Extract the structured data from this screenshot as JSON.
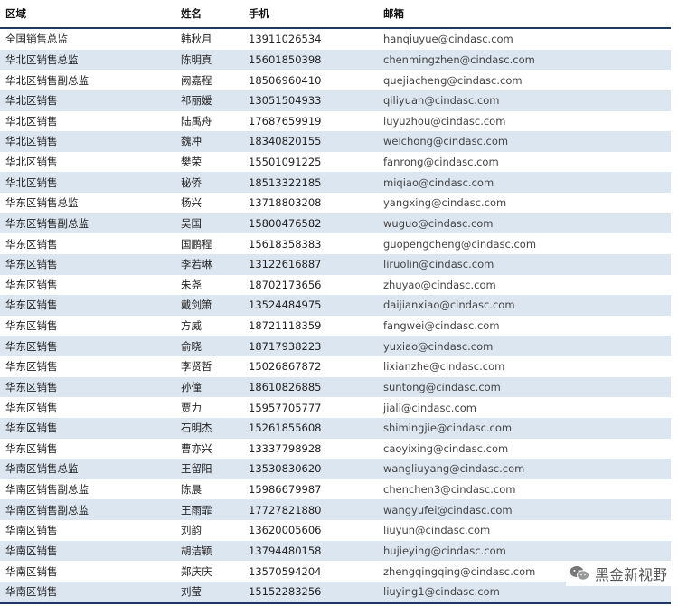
{
  "table": {
    "headers": [
      "区域",
      "姓名",
      "手机",
      "邮箱"
    ],
    "rows": [
      [
        "全国销售总监",
        "韩秋月",
        "13911026534",
        "hanqiuyue@cindasc.com"
      ],
      [
        "华北区销售总监",
        "陈明真",
        "15601850398",
        "chenmingzhen@cindasc.com"
      ],
      [
        "华北区销售副总监",
        "阙嘉程",
        "18506960410",
        "quejiacheng@cindasc.com"
      ],
      [
        "华北区销售",
        "祁丽媛",
        "13051504933",
        "qiliyuan@cindasc.com"
      ],
      [
        "华北区销售",
        "陆禹舟",
        "17687659919",
        "luyuzhou@cindasc.com"
      ],
      [
        "华北区销售",
        "魏冲",
        "18340820155",
        "weichong@cindasc.com"
      ],
      [
        "华北区销售",
        "樊荣",
        "15501091225",
        "fanrong@cindasc.com"
      ],
      [
        "华北区销售",
        "秘侨",
        "18513322185",
        "miqiao@cindasc.com"
      ],
      [
        "华东区销售总监",
        "杨兴",
        "13718803208",
        "yangxing@cindasc.com"
      ],
      [
        "华东区销售副总监",
        "吴国",
        "15800476582",
        "wuguo@cindasc.com"
      ],
      [
        "华东区销售",
        "国鹏程",
        "15618358383",
        "guopengcheng@cindasc.com"
      ],
      [
        "华东区销售",
        "李若琳",
        "13122616887",
        "liruolin@cindasc.com"
      ],
      [
        "华东区销售",
        "朱尧",
        "18702173656",
        "zhuyao@cindasc.com"
      ],
      [
        "华东区销售",
        "戴剑箫",
        "13524484975",
        "daijianxiao@cindasc.com"
      ],
      [
        "华东区销售",
        "方威",
        "18721118359",
        "fangwei@cindasc.com"
      ],
      [
        "华东区销售",
        "俞晓",
        "18717938223",
        "yuxiao@cindasc.com"
      ],
      [
        "华东区销售",
        "李贤哲",
        "15026867872",
        "lixianzhe@cindasc.com"
      ],
      [
        "华东区销售",
        "孙僮",
        "18610826885",
        "suntong@cindasc.com"
      ],
      [
        "华东区销售",
        "贾力",
        "15957705777",
        "jiali@cindasc.com"
      ],
      [
        "华东区销售",
        "石明杰",
        "15261855608",
        "shimingjie@cindasc.com"
      ],
      [
        "华东区销售",
        "曹亦兴",
        "13337798928",
        "caoyixing@cindasc.com"
      ],
      [
        "华南区销售总监",
        "王留阳",
        "13530830620",
        "wangliuyang@cindasc.com"
      ],
      [
        "华南区销售副总监",
        "陈晨",
        "15986679987",
        "chenchen3@cindasc.com"
      ],
      [
        "华南区销售副总监",
        "王雨霏",
        "17727821880",
        "wangyufei@cindasc.com"
      ],
      [
        "华南区销售",
        "刘韵",
        "13620005606",
        "liuyun@cindasc.com"
      ],
      [
        "华南区销售",
        "胡洁颖",
        "13794480158",
        "hujieying@cindasc.com"
      ],
      [
        "华南区销售",
        "郑庆庆",
        "13570594204",
        "zhengqingqing@cindasc.com"
      ],
      [
        "华南区销售",
        "刘莹",
        "15152283256",
        "liuying1@cindasc.com"
      ]
    ]
  },
  "watermark": {
    "text": "黑金新视野",
    "icon": "wechat-icon"
  },
  "colors": {
    "header_rule": "#1f3864",
    "stripe": "#dce6f1"
  }
}
